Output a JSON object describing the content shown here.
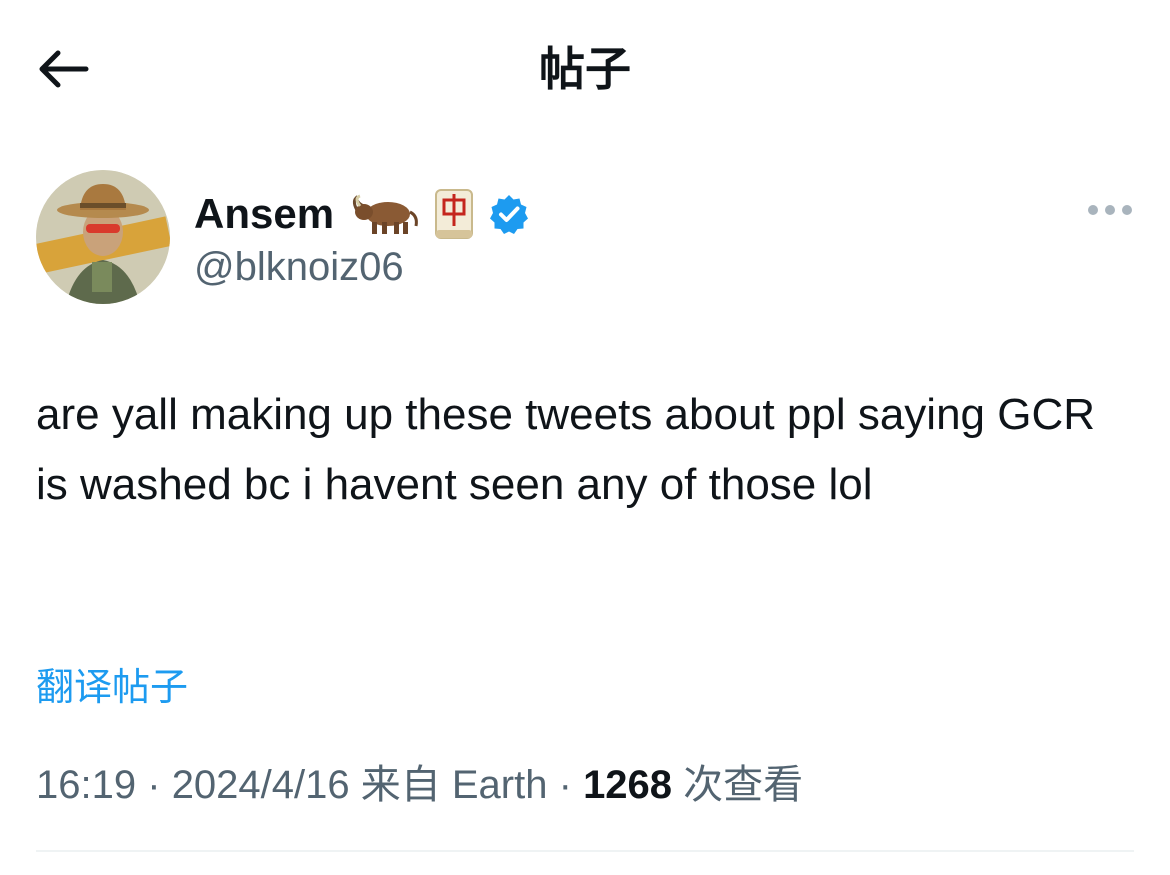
{
  "header": {
    "title": "帖子",
    "back_icon": "arrow-left-icon"
  },
  "author": {
    "display_name": "Ansem",
    "handle": "@blknoiz06",
    "badges": [
      "ox-emoji",
      "mahjong-red-dragon-emoji",
      "verified-badge-icon"
    ],
    "verified_color": "#1d9bf0"
  },
  "tweet": {
    "text": "are yall making up these tweets about ppl saying GCR is washed bc i havent seen any of those lol"
  },
  "translate": {
    "label": "翻译帖子"
  },
  "meta": {
    "time": "16:19",
    "date": "2024/4/16",
    "source": "来自 Earth",
    "views_count": "1268",
    "views_label": "次查看",
    "separator": "·"
  },
  "colors": {
    "text": "#0f1419",
    "secondary": "#536471",
    "link": "#1d9bf0",
    "divider": "#eff3f4"
  }
}
